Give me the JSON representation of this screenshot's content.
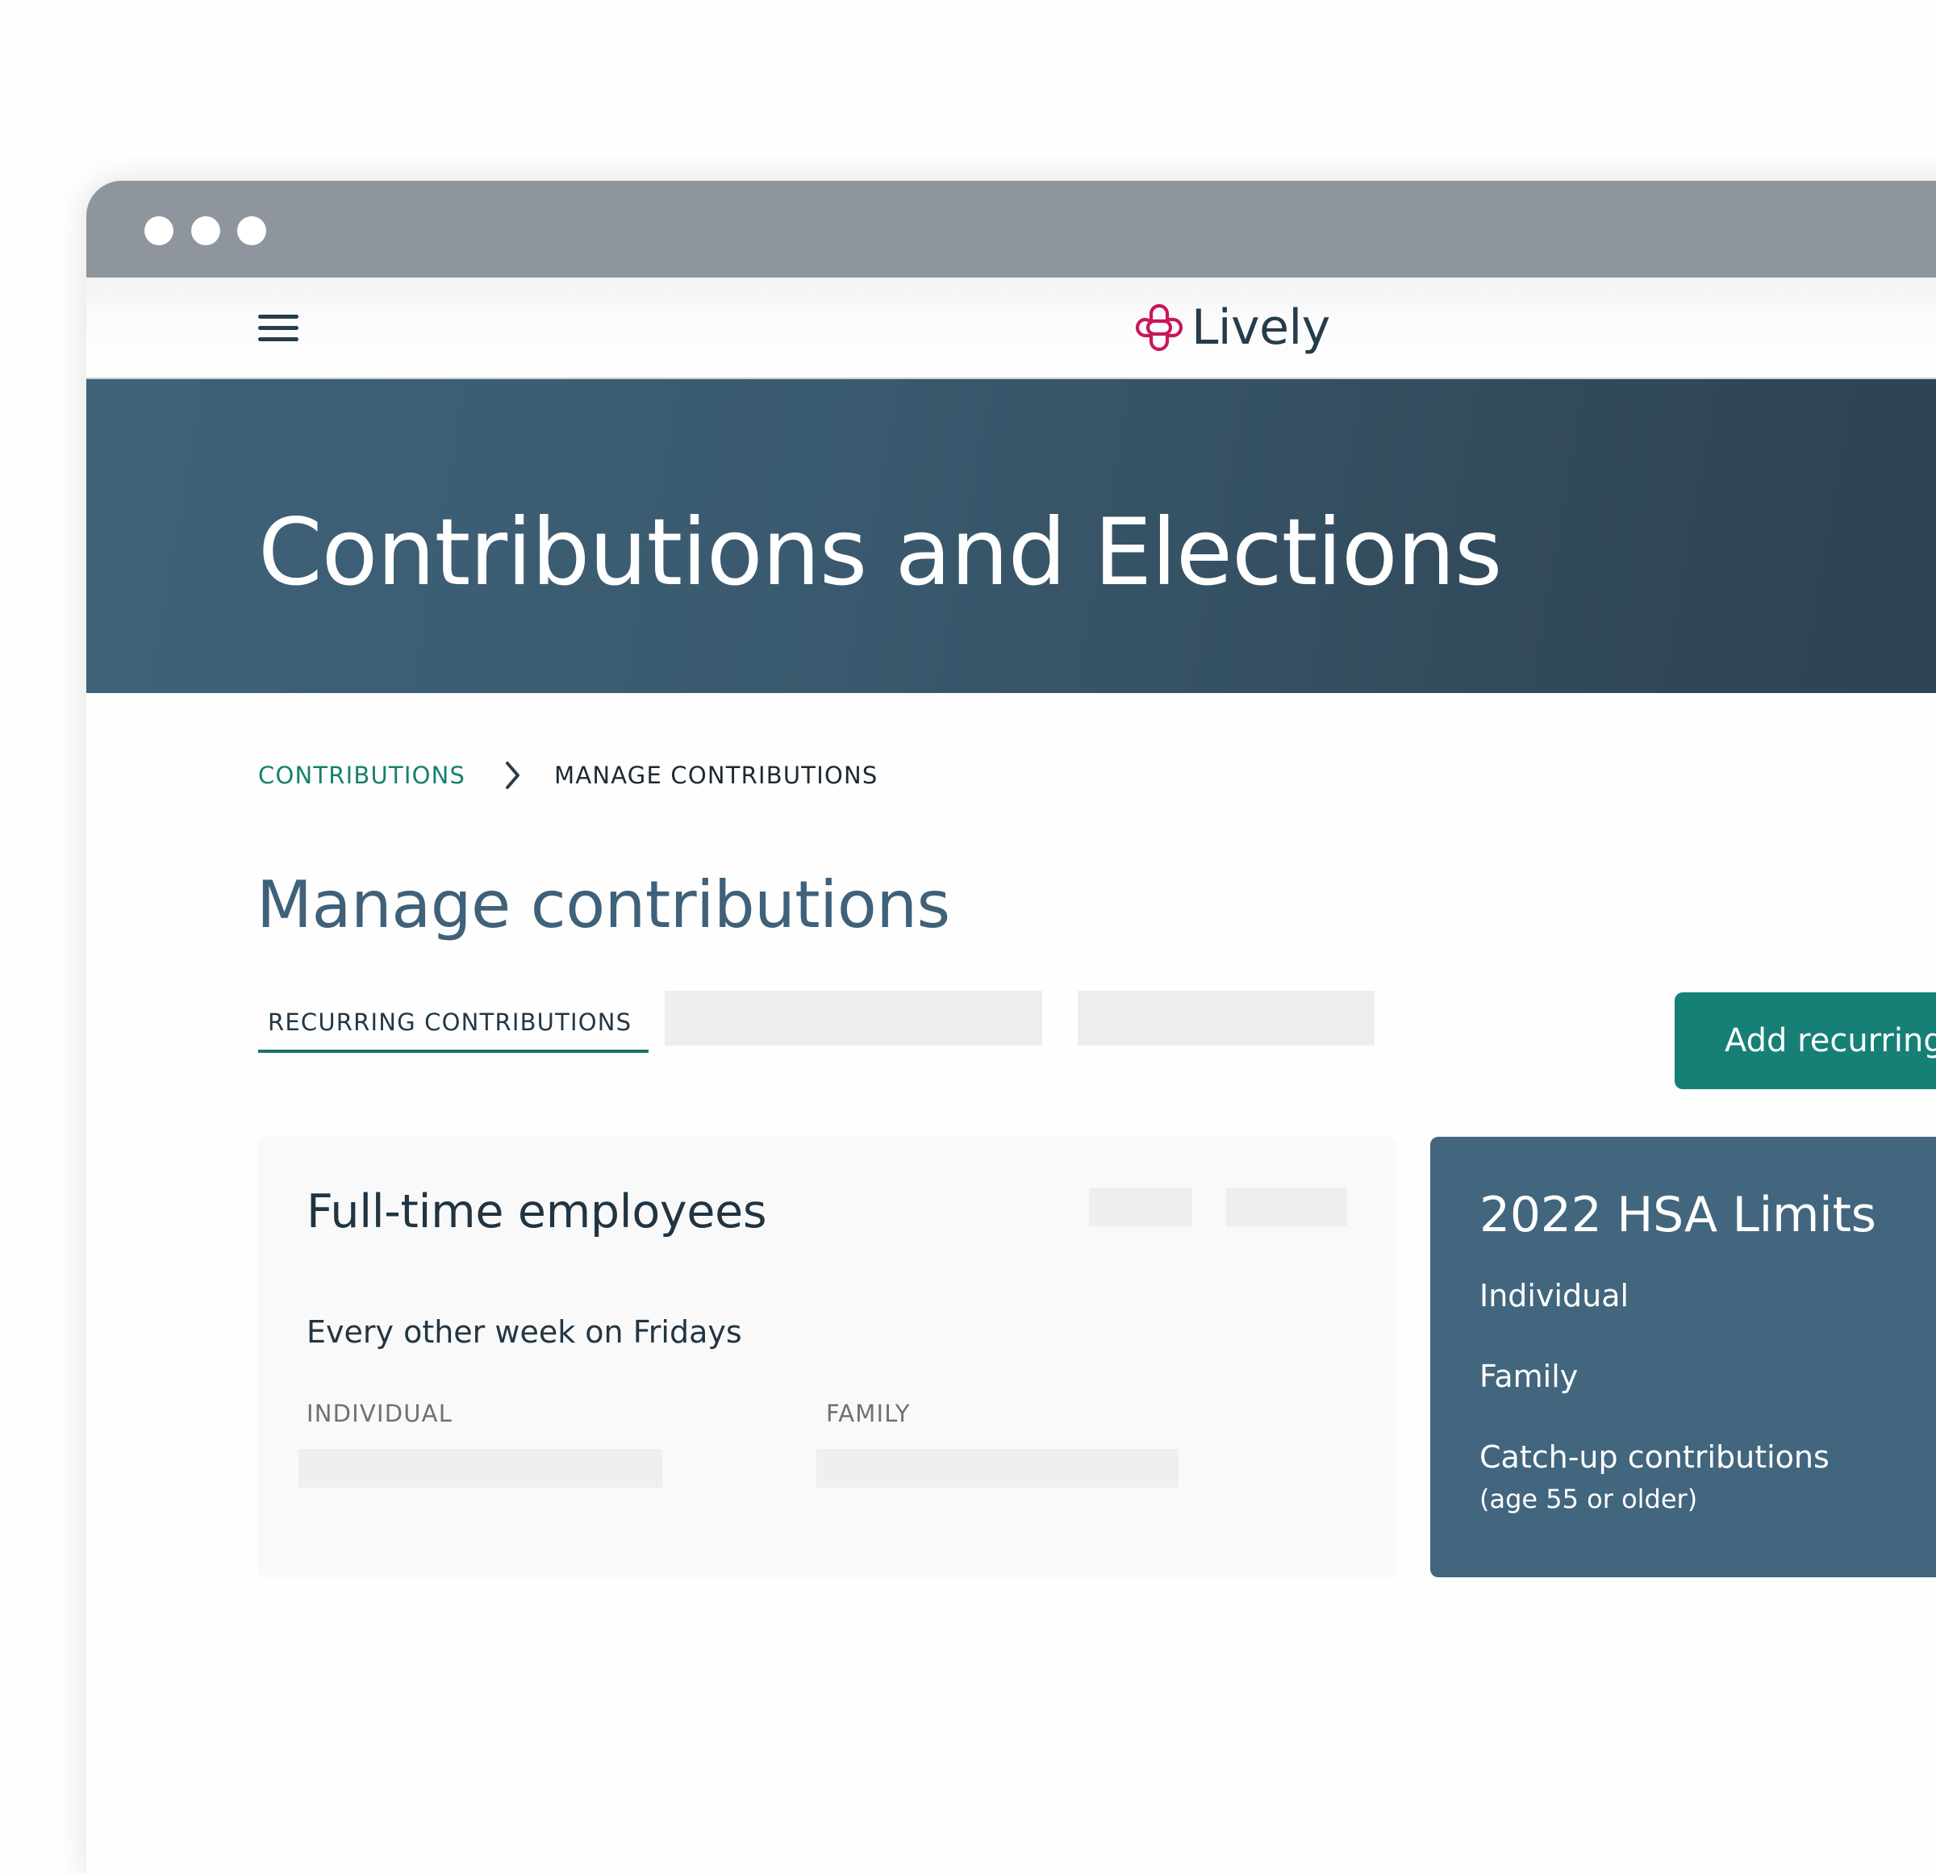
{
  "window": {
    "controls": [
      "window-dot",
      "window-dot",
      "window-dot"
    ]
  },
  "navbar": {
    "menu_icon": "hamburger-menu-icon",
    "brand": {
      "name": "Lively",
      "icon": "lively-logo-icon",
      "icon_color": "#c8175b",
      "text_color": "#263c4a"
    }
  },
  "hero": {
    "title": "Contributions and Elections"
  },
  "breadcrumb": {
    "items": [
      {
        "label": "CONTRIBUTIONS",
        "link": true
      },
      {
        "label": "MANAGE CONTRIBUTIONS",
        "link": false
      }
    ],
    "separator_icon": "chevron-right-icon"
  },
  "page": {
    "title": "Manage contributions"
  },
  "tabs": {
    "active": {
      "label": "RECURRING CONTRIBUTIONS"
    },
    "placeholders": 2
  },
  "actions": {
    "add_recurring_label": "Add recurring"
  },
  "contribution_card": {
    "title": "Full-time employees",
    "schedule": "Every other week on Fridays",
    "columns": [
      {
        "label": "INDIVIDUAL"
      },
      {
        "label": "FAMILY"
      }
    ]
  },
  "hsa_limits": {
    "title": "2022 HSA Limits",
    "items": [
      {
        "label": "Individual"
      },
      {
        "label": "Family"
      },
      {
        "label": "Catch-up contributions",
        "note": "(age 55 or older)"
      }
    ]
  },
  "colors": {
    "accent_teal": "#168077",
    "hero_start": "#3f6279",
    "hero_end": "#2d4353",
    "hsa_card": "#42667e",
    "brand_pink": "#c8175b",
    "titlebar": "#8e959d"
  }
}
